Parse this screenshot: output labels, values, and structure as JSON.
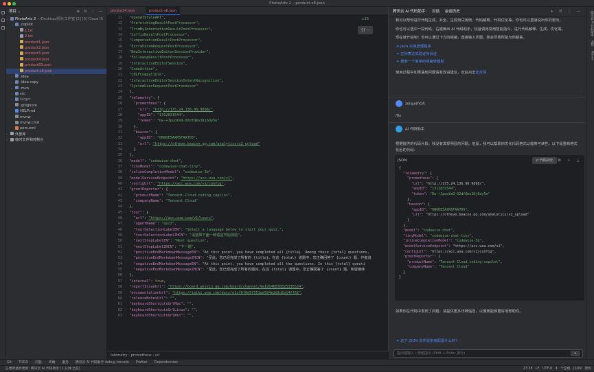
{
  "window": {
    "title": "PhotoArts 2 – product-s8.json"
  },
  "project": {
    "header": "项目",
    "root": "PhotoArts 2",
    "root_suffix": "~/Desktop/照片工作室 [2]  [3] Cloud IS",
    "tree": [
      {
        "name": ".copilot",
        "indent": 1,
        "type": "folder",
        "open": true,
        "color": "normal"
      },
      {
        "name": "1.txt",
        "indent": 2,
        "type": "txt",
        "color": "red"
      },
      {
        "name": "2.txt",
        "indent": 2,
        "type": "txt",
        "color": "red"
      },
      {
        "name": "product1.json",
        "indent": 2,
        "type": "json",
        "color": "red"
      },
      {
        "name": "product2.json",
        "indent": 2,
        "type": "json",
        "color": "red"
      },
      {
        "name": "product3.json",
        "indent": 2,
        "type": "json",
        "color": "red"
      },
      {
        "name": "product4.json",
        "indent": 2,
        "type": "json",
        "color": "red"
      },
      {
        "name": "product83.json",
        "indent": 2,
        "type": "json",
        "color": "red"
      },
      {
        "name": "product-s8.json",
        "indent": 2,
        "type": "json",
        "color": "red",
        "selected": true
      },
      {
        "name": ".idea",
        "indent": 1,
        "type": "folder",
        "color": "normal"
      },
      {
        "name": ".idea copy",
        "indent": 1,
        "type": "folder",
        "color": "normal"
      },
      {
        "name": ".mvn",
        "indent": 1,
        "type": "folder",
        "color": "normal"
      },
      {
        "name": "src",
        "indent": 1,
        "type": "folder",
        "color": "normal"
      },
      {
        "name": "target",
        "indent": 1,
        "type": "folder",
        "color": "dim"
      },
      {
        "name": ".gitignore",
        "indent": 1,
        "type": "file",
        "color": "normal"
      },
      {
        "name": "HELP.md",
        "indent": 1,
        "type": "md",
        "color": "normal"
      },
      {
        "name": "mvnw",
        "indent": 1,
        "type": "file",
        "color": "normal"
      },
      {
        "name": "mvnw.cmd",
        "indent": 1,
        "type": "file",
        "color": "normal"
      },
      {
        "name": "pom.xml",
        "indent": 1,
        "type": "xml",
        "color": "normal"
      },
      {
        "name": "外部库",
        "indent": 0,
        "type": "lib",
        "color": "normal"
      },
      {
        "name": "临时文件和控制台",
        "indent": 0,
        "type": "scratch",
        "color": "normal"
      }
    ]
  },
  "editor": {
    "tabs": [
      "product4.json",
      "product-s8.json"
    ],
    "inspection": "⚠16",
    "floater": "{} ⋯",
    "gutter_start": 11,
    "lines": [
      "\"OpenAIStyleAPI\",",
      "\"PrefetchingResultPostProcessor\",",
      "\"TrimByIndentationResultPostProcessor\",",
      "\"SuffixResultPostProcessor\",",
      "\"CompensationResultPostProcessor\",",
      "\"ExtraParamRequestPostProcessor\",",
      "\"NewInteractiveEditorSessionProvider\",",
      "\"FollowupResultPostProcessor\",",
      "\"InteractiveEditorSession\",",
      "\"CodeAction\",",
      "\"CHLFCompatible\",",
      "\"InteractiveEditorSessionIntentRecognition\",",
      "\"SystemUserRequestPostProcessor\"",
      "],",
      "\"telemetry\": {",
      "  \"prometheus\": {",
      "    \"url\": \"http://175.24.136.96:9898/\",",
      "    \"appID\": \"1312831544\",",
      "    \"token\": \"Dw-+JpuqYeQ-02dfQmv1Kj6dy5e\"",
      "  },",
      "  \"beacon\": {",
      "    \"appID\": \"0N0DE5AXR5FAA7D5\",",
      "    \"url\": \"https://otheve.beacon.qq.com/analytics/v2_upload\"",
      "  }",
      "},",
      "\"model\": \"codewise-chat\",",
      "\"tinyModel\": \"codewise-chat-tiny\",",
      "\"inlineCompletionModel\": \"codewise-3b\",",
      "\"modelServiceEndpoint\": \"https://acc.woa.com/v1\",",
      "\"configUrl\": \"https://acc.woa.com/v1/config\",",
      "\"greetReporter\": {",
      "  \"productName\": \"Tencent-Cloud.coding-copilot\",",
      "  \"companyName\": \"Tencent Cloud\"",
      "},",
      "\"tour\": {",
      "  \"url\": \"https://acc.woa.com/v1/tours\",",
      "  \"agentName\": \"quiz\",",
      "  \"tourSelectionLabelEN\": \"Select a language below to start your quiz.\",",
      "  \"tourSelectionLabelZHCN\": \"请选择下面一种语言开始测验\",",
      "  \"nextStepLabelEN\": \"Next question\",",
      "  \"nextStepLabelZHCN\": \"下一题\",",
      "  \"positiveEndMarkdownMessageEN\": \"At this point, you have completed all {title}. Among these {total} questions,",
      "  \"positiveEndMarkdownMessageZHCN\": \"至此，您已经完成了所有的 {title}。在这 {total} 道题中，您正确回答了 {count} 题，作者说",
      "  \"negativeEndMarkdownMessageEN\": \"At this point, you have completed all the questions. In this {total} questi",
      "  \"negativeEndMarkdownMessageZHCN\": \"至此，您已经完成了所有的题目。在这 {total} 道题中，您正确回答了 {count} 题，希望继续",
      "},",
      "\"internal\": true,",
      "\"reportIssueUrl\": \"https://board.weixin.qq.com/board/channel/9e19146830825336524\",",
      "\"documentationUrl\": \"https://iwiki.woa.com/docs/e1cf0f0d9f551ae924e2d2d2e14ff62\",",
      "\"releaseNotesUrl\": \"\",",
      "\"keyboardShortcutsUrlMac\": \"\",",
      "\"keyboardShortcutsUrlLinux\": \"\",",
      "\"keyboardShortcutsUrlWin\": \"\","
    ],
    "breadcrumbs": [
      "telemetry",
      "prometheus",
      "url"
    ]
  },
  "assistant": {
    "header": "腾讯云 AI 代码助手:",
    "header_tabs": [
      "对话",
      "会话历史"
    ],
    "intro_lines": [
      "我可以帮你进行代码生成、补全、生成测试用例、代码解释、代码优化等。你也可以直接说出你的想法。",
      "",
      "你也可以选中一段代码，右键唤出 AI 代码助手，快速调用常用智能指令，进行代码解释、生成、优化等。",
      "",
      "现在就开始吧！也可以通过下方的链接，直接输入问题，我会尽我所能为你解答。"
    ],
    "links": [
      "Java 实用管理程序",
      "正则表达式验证身份证",
      "搜索一个简单的维度转模板"
    ],
    "tip_prefix": "使用过程中如果遇到问题请有改进建议，欢迎点击",
    "tip_link": "此反馈",
    "user_name": "zeiqudhOA",
    "user_message": "/fix",
    "bot_name": "AI 代码助手",
    "bot_intro": "根据提供的代码片段，我没有发现明显的问题。但是，我可以帮助你优化代码格式以提高可读性。以下是重新格式化后的代码：",
    "code_lang": "JSON",
    "code_button": "代码对比",
    "code_lines": [
      "{",
      "  \"telemetry\": {",
      "    \"prometheus\": {",
      "      \"url\": \"http://175.24.136.96:9898/\",",
      "      \"appID\": \"1312831544\",",
      "      \"token\": \"Dw-+JpuqYeQ-02dfQmv1Kj6dy5e\"",
      "    },",
      "    \"beacon\": {",
      "      \"appID\": \"0N0DE5AXR5FAA7D5\",",
      "      \"url\": \"https://otheve.beacon.qq.com/analytics/v2_upload\"",
      "    }",
      "  },",
      "  \"model\": \"codewise-chat\",",
      "  \"tinyModel\": \"codewise-chat-tiny\",",
      "  \"inlineCompletionModel\": \"codewise-3b\",",
      "  \"modelServiceEndpoint\": \"https://acc.woa.com/v1\",",
      "  \"configUrl\": \"https://acc.woa.com/v1/config\",",
      "  \"greetReporter\": {",
      "    \"productName\": \"Tencent-Cloud.coding-copilot\",",
      "    \"companyName\": \"Tencent Cloud\"",
      "  }",
      "}"
    ],
    "outro": "如果你在代码中发现了问题，请提供更多详细信息，以便我能够更好地帮助你。",
    "followup": "这个 JSON 文件是用来配置什么的?",
    "input_placeholder": "提问或输入 / 使用指令 (Shift + Enter 换行)",
    "send": "➤"
  },
  "right_bar": [
    "腾讯云 AI 代码助手",
    "通知",
    "Maven"
  ],
  "tool_windows": [
    "Git",
    "TODO",
    "问题",
    "终端",
    "服务",
    "腾讯云 AI 代码助手 debug console",
    "Profiler",
    "Dependencies"
  ],
  "status": {
    "left": "已更新插件更新: 腾讯云 AI 代码助手 (1 分钟 之前)",
    "right": [
      "27:38",
      "LF",
      "UTF-8",
      "4 个空格",
      "JSON 架构"
    ]
  },
  "colors": {
    "accent": "#3574f0",
    "string": "#6aab73",
    "key": "#c77dbb",
    "modified": "#e06c75",
    "link": "#548af7"
  }
}
